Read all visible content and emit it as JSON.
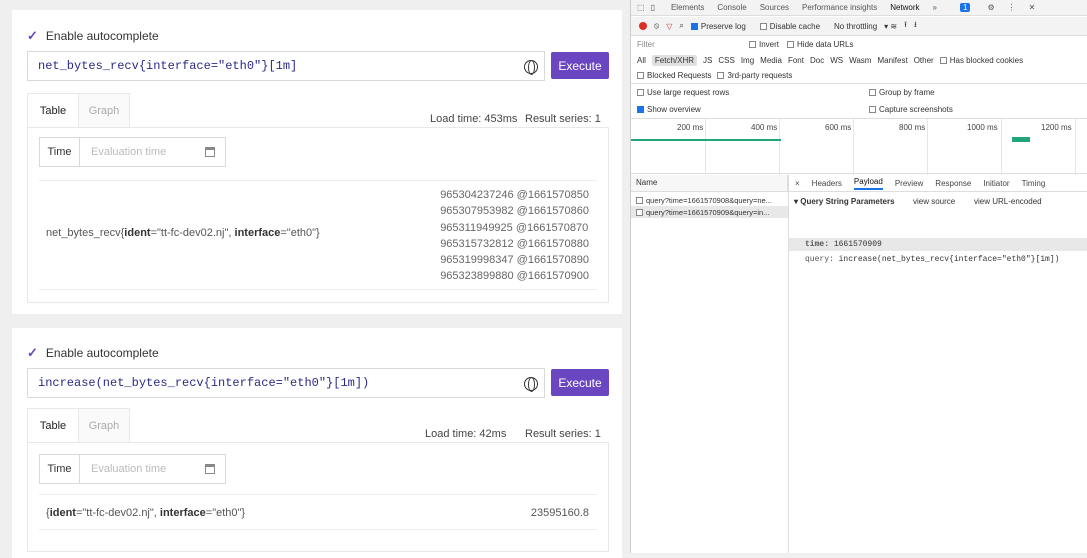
{
  "panels": [
    {
      "autocomplete_label": "Enable autocomplete",
      "expression": "net_bytes_recv{interface=\"eth0\"}[1m]",
      "execute_label": "Execute",
      "tab_table": "Table",
      "tab_graph": "Graph",
      "load_time": "Load time: 453ms",
      "result_series": "Result series: 1",
      "eval_label": "Time",
      "eval_placeholder": "Evaluation time",
      "metric": "net_bytes_recv",
      "label_ident_key": "ident",
      "label_ident_val": "=\"tt-fc-dev02.nj\", ",
      "label_iface_key": "interface",
      "label_iface_val": "=\"eth0\"}",
      "values": [
        "965304237246 @1661570850",
        "965307953982 @1661570860",
        "965311949925 @1661570870",
        "965315732812 @1661570880",
        "965319998347 @1661570890",
        "965323899880 @1661570900"
      ]
    },
    {
      "autocomplete_label": "Enable autocomplete",
      "expression": "increase(net_bytes_recv{interface=\"eth0\"}[1m])",
      "execute_label": "Execute",
      "tab_table": "Table",
      "tab_graph": "Graph",
      "load_time": "Load time: 42ms",
      "result_series": "Result series: 1",
      "eval_label": "Time",
      "eval_placeholder": "Evaluation time",
      "label_ident_key": "ident",
      "label_ident_val": "=\"tt-fc-dev02.nj\", ",
      "label_iface_key": "interface",
      "label_iface_val": "=\"eth0\"}",
      "value": "23595160.8"
    }
  ],
  "devtools": {
    "tabs": [
      "Elements",
      "Console",
      "Sources",
      "Performance insights",
      "Network",
      "»"
    ],
    "active_tab": "Network",
    "badge": "1",
    "toolbar": {
      "preserve_log": "Preserve log",
      "disable_cache": "Disable cache",
      "throttling": "No throttling"
    },
    "filter_placeholder": "Filter",
    "invert": "Invert",
    "hide_data_urls": "Hide data URLs",
    "types": [
      "All",
      "Fetch/XHR",
      "JS",
      "CSS",
      "Img",
      "Media",
      "Font",
      "Doc",
      "WS",
      "Wasm",
      "Manifest",
      "Other"
    ],
    "has_blocked_cookies": "Has blocked cookies",
    "blocked_requests": "Blocked Requests",
    "third_party": "3rd-party requests",
    "large_rows": "Use large request rows",
    "group_by_frame": "Group by frame",
    "show_overview": "Show overview",
    "capture_screenshots": "Capture screenshots",
    "timeline_ticks": [
      "200 ms",
      "400 ms",
      "600 ms",
      "800 ms",
      "1000 ms",
      "1200 ms"
    ],
    "name_header": "Name",
    "requests": [
      "query?time=1661570908&query=ne...",
      "query?time=1661570909&query=in..."
    ],
    "detail_tabs": [
      "×",
      "Headers",
      "Payload",
      "Preview",
      "Response",
      "Initiator",
      "Timing"
    ],
    "active_detail_tab": "Payload",
    "qs_title": "Query String Parameters",
    "view_source": "view source",
    "view_url_encoded": "view URL-encoded",
    "param_time_key": "time:",
    "param_time_val": "1661570909",
    "param_query_key": "query:",
    "param_query_val": "increase(net_bytes_recv{interface=\"eth0\"}[1m])"
  },
  "colors": {
    "accent": "#6b46c1",
    "devtools_blue": "#1a73e8",
    "timeline_green": "#21a67a"
  }
}
